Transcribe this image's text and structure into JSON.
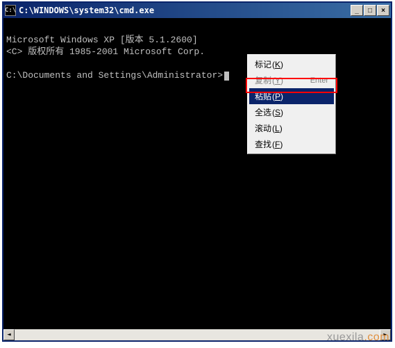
{
  "titlebar": {
    "icon_text": "C:\\",
    "title": "C:\\WINDOWS\\system32\\cmd.exe",
    "minimize": "_",
    "maximize": "□",
    "close": "×"
  },
  "console": {
    "line1": "Microsoft Windows XP [版本 5.1.2600]",
    "line2": "<C> 版权所有 1985-2001 Microsoft Corp.",
    "prompt": "C:\\Documents and Settings\\Administrator>"
  },
  "menu": {
    "items": [
      {
        "label": "标记",
        "hotkey": "K",
        "enabled": true,
        "highlighted": false
      },
      {
        "label": "复制",
        "hotkey": "Y",
        "accel": "Enter",
        "enabled": false,
        "highlighted": false
      },
      {
        "label": "粘贴",
        "hotkey": "P",
        "enabled": true,
        "highlighted": true
      },
      {
        "label": "全选",
        "hotkey": "S",
        "enabled": true,
        "highlighted": false
      },
      {
        "label": "滚动",
        "hotkey": "L",
        "enabled": true,
        "highlighted": false
      },
      {
        "label": "查找",
        "hotkey": "F",
        "enabled": true,
        "highlighted": false
      }
    ]
  },
  "scrollbar": {
    "left": "◄",
    "right": "►"
  },
  "watermark": {
    "main": "xuexila",
    "suffix": ".com"
  }
}
